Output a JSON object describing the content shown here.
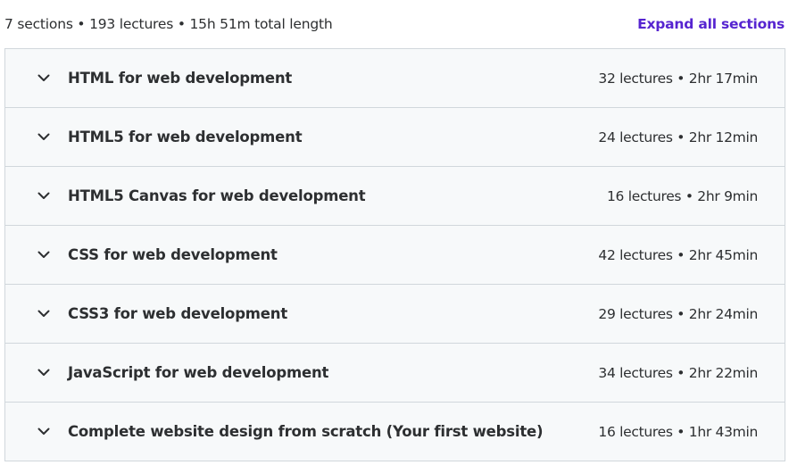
{
  "summary": {
    "text": "7 sections • 193 lectures • 15h 51m total length",
    "expand_label": "Expand all sections"
  },
  "sections": [
    {
      "title": "HTML for web development",
      "meta": "32 lectures • 2hr 17min"
    },
    {
      "title": "HTML5 for web development",
      "meta": "24 lectures • 2hr 12min"
    },
    {
      "title": "HTML5 Canvas for web development",
      "meta": "16 lectures • 2hr 9min"
    },
    {
      "title": "CSS for web development",
      "meta": "42 lectures • 2hr 45min"
    },
    {
      "title": "CSS3 for web development",
      "meta": "29 lectures • 2hr 24min"
    },
    {
      "title": "JavaScript for web development",
      "meta": "34 lectures • 2hr 22min"
    },
    {
      "title": "Complete website design from scratch (Your first website)",
      "meta": "16 lectures • 1hr 43min"
    }
  ],
  "icons": {
    "expander": "chevron-down-icon"
  },
  "colors": {
    "accent": "#5624d0",
    "row_bg": "#f7f9fa",
    "border": "#d1d7dc",
    "text": "#2d2f31"
  }
}
